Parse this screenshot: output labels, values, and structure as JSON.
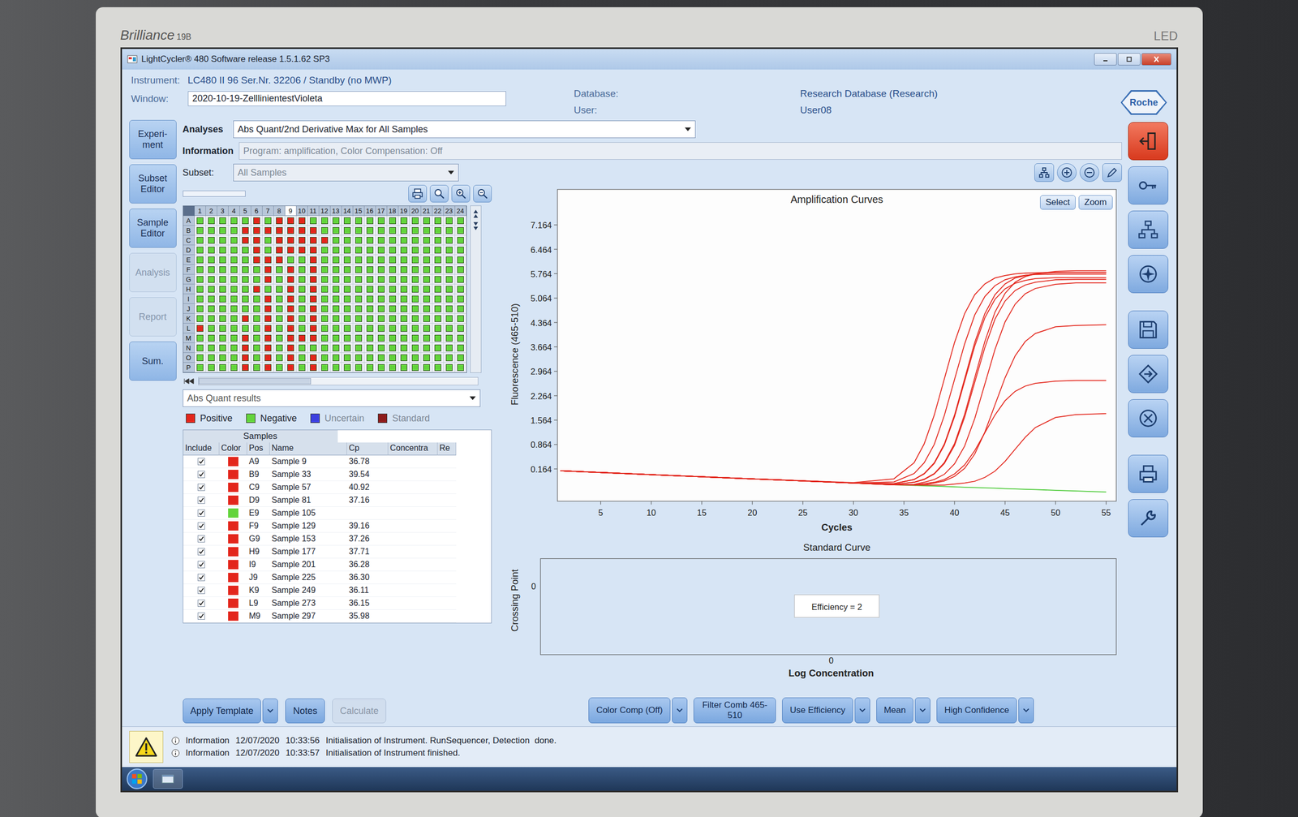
{
  "monitor": {
    "brand": "Brilliance",
    "model": "19B",
    "badge": "LED"
  },
  "window": {
    "title": "LightCycler® 480 Software release 1.5.1.62 SP3"
  },
  "header": {
    "instrument_label": "Instrument:",
    "instrument": "LC480 II 96 Ser.Nr. 32206 / Standby (no MWP)",
    "window_label": "Window:",
    "window_value": "2020-10-19-ZelllinientestVioleta",
    "database_label": "Database:",
    "database": "Research Database (Research)",
    "user_label": "User:",
    "user": "User08",
    "logo": "Roche"
  },
  "sidebar": {
    "items": [
      {
        "label": "Experi-ment",
        "disabled": false
      },
      {
        "label": "Subset Editor",
        "disabled": false
      },
      {
        "label": "Sample Editor",
        "disabled": false
      },
      {
        "label": "Analysis",
        "disabled": true
      },
      {
        "label": "Report",
        "disabled": true
      },
      {
        "label": "Sum.",
        "disabled": false
      }
    ]
  },
  "analyses": {
    "label": "Analyses",
    "value": "Abs Quant/2nd Derivative Max for All Samples"
  },
  "information": {
    "label": "Information",
    "value": "Program: amplification, Color Compensation: Off"
  },
  "subset": {
    "label": "Subset:",
    "value": "All Samples"
  },
  "plate": {
    "columns": [
      {
        "label": "1",
        "selected": false
      },
      {
        "label": "2",
        "selected": false
      },
      {
        "label": "3",
        "selected": false
      },
      {
        "label": "4",
        "selected": false
      },
      {
        "label": "5",
        "selected": false
      },
      {
        "label": "6",
        "selected": false
      },
      {
        "label": "7",
        "selected": false
      },
      {
        "label": "8",
        "selected": false
      },
      {
        "label": "9",
        "selected": true
      },
      {
        "label": "10",
        "selected": false
      },
      {
        "label": "11",
        "selected": false
      },
      {
        "label": "12",
        "selected": false
      },
      {
        "label": "13",
        "selected": false
      },
      {
        "label": "14",
        "selected": false
      },
      {
        "label": "15",
        "selected": false
      },
      {
        "label": "16",
        "selected": false
      },
      {
        "label": "17",
        "selected": false
      },
      {
        "label": "18",
        "selected": false
      },
      {
        "label": "19",
        "selected": false
      },
      {
        "label": "20",
        "selected": false
      },
      {
        "label": "21",
        "selected": false
      },
      {
        "label": "22",
        "selected": false
      },
      {
        "label": "23",
        "selected": false
      },
      {
        "label": "24",
        "selected": false
      }
    ],
    "rows": [
      {
        "label": "A",
        "positive": [
          false,
          false,
          false,
          false,
          false,
          true,
          false,
          true,
          true,
          true,
          false,
          false,
          false,
          false,
          false,
          false,
          false,
          false,
          false,
          false,
          false,
          false,
          false,
          false
        ]
      },
      {
        "label": "B",
        "positive": [
          false,
          false,
          false,
          false,
          true,
          true,
          true,
          true,
          true,
          true,
          true,
          false,
          false,
          false,
          false,
          false,
          false,
          false,
          false,
          false,
          false,
          false,
          false,
          false
        ]
      },
      {
        "label": "C",
        "positive": [
          false,
          false,
          false,
          false,
          true,
          true,
          false,
          true,
          true,
          true,
          true,
          true,
          false,
          false,
          false,
          false,
          false,
          false,
          false,
          false,
          false,
          false,
          false,
          false
        ]
      },
      {
        "label": "D",
        "positive": [
          false,
          false,
          false,
          false,
          false,
          true,
          false,
          true,
          true,
          true,
          true,
          false,
          false,
          false,
          false,
          false,
          false,
          false,
          false,
          false,
          false,
          false,
          false,
          false
        ]
      },
      {
        "label": "E",
        "positive": [
          false,
          false,
          false,
          false,
          false,
          true,
          true,
          true,
          false,
          false,
          true,
          false,
          false,
          false,
          false,
          false,
          false,
          false,
          false,
          false,
          false,
          false,
          false,
          false
        ]
      },
      {
        "label": "F",
        "positive": [
          false,
          false,
          false,
          false,
          false,
          false,
          true,
          false,
          true,
          false,
          true,
          false,
          false,
          false,
          false,
          false,
          false,
          false,
          false,
          false,
          false,
          false,
          false,
          false
        ]
      },
      {
        "label": "G",
        "positive": [
          false,
          false,
          false,
          false,
          false,
          false,
          true,
          false,
          true,
          false,
          true,
          false,
          false,
          false,
          false,
          false,
          false,
          false,
          false,
          false,
          false,
          false,
          false,
          false
        ]
      },
      {
        "label": "H",
        "positive": [
          false,
          false,
          false,
          false,
          false,
          true,
          false,
          false,
          true,
          false,
          true,
          false,
          false,
          false,
          false,
          false,
          false,
          false,
          false,
          false,
          false,
          false,
          false,
          false
        ]
      },
      {
        "label": "I",
        "positive": [
          false,
          false,
          false,
          false,
          false,
          false,
          true,
          false,
          true,
          false,
          true,
          false,
          false,
          false,
          false,
          false,
          false,
          false,
          false,
          false,
          false,
          false,
          false,
          false
        ]
      },
      {
        "label": "J",
        "positive": [
          false,
          false,
          false,
          false,
          false,
          false,
          true,
          false,
          true,
          false,
          true,
          false,
          false,
          false,
          false,
          false,
          false,
          false,
          false,
          false,
          false,
          false,
          false,
          false
        ]
      },
      {
        "label": "K",
        "positive": [
          false,
          false,
          false,
          false,
          true,
          false,
          true,
          false,
          true,
          false,
          true,
          false,
          false,
          false,
          false,
          false,
          false,
          false,
          false,
          false,
          false,
          false,
          false,
          false
        ]
      },
      {
        "label": "L",
        "positive": [
          true,
          false,
          false,
          false,
          false,
          false,
          true,
          false,
          true,
          false,
          true,
          false,
          false,
          false,
          false,
          false,
          false,
          false,
          false,
          false,
          false,
          false,
          false,
          false
        ]
      },
      {
        "label": "M",
        "positive": [
          false,
          false,
          false,
          false,
          true,
          false,
          true,
          false,
          true,
          true,
          true,
          false,
          false,
          false,
          false,
          false,
          false,
          false,
          false,
          false,
          false,
          false,
          false,
          false
        ]
      },
      {
        "label": "N",
        "positive": [
          false,
          false,
          false,
          false,
          true,
          false,
          true,
          false,
          true,
          false,
          false,
          false,
          false,
          false,
          false,
          false,
          false,
          false,
          false,
          false,
          false,
          false,
          false,
          false
        ]
      },
      {
        "label": "O",
        "positive": [
          false,
          false,
          false,
          false,
          true,
          false,
          true,
          false,
          true,
          false,
          true,
          false,
          false,
          false,
          false,
          false,
          false,
          false,
          false,
          false,
          false,
          false,
          false,
          false
        ]
      },
      {
        "label": "P",
        "positive": [
          false,
          false,
          false,
          false,
          true,
          false,
          true,
          false,
          true,
          false,
          true,
          false,
          false,
          false,
          false,
          false,
          false,
          false,
          false,
          false,
          false,
          false,
          false,
          false
        ]
      }
    ]
  },
  "results": {
    "value": "Abs Quant results"
  },
  "legend": [
    {
      "label": "Positive",
      "color": "#e3261c",
      "disabled": false
    },
    {
      "label": "Negative",
      "color": "#63d43c",
      "disabled": false
    },
    {
      "label": "Uncertain",
      "color": "#3b3fe0",
      "disabled": true
    },
    {
      "label": "Standard",
      "color": "#8e1c1c",
      "disabled": true
    }
  ],
  "samples": {
    "title": "Samples",
    "columns": [
      "Include",
      "Color",
      "Pos",
      "Name",
      "Cp",
      "Concentra",
      "Re"
    ],
    "rows": [
      {
        "included": true,
        "positive": true,
        "pos": "A9",
        "name": "Sample 9",
        "cp": "36.78",
        "concentration": ""
      },
      {
        "included": true,
        "positive": true,
        "pos": "B9",
        "name": "Sample 33",
        "cp": "39.54",
        "concentration": ""
      },
      {
        "included": true,
        "positive": true,
        "pos": "C9",
        "name": "Sample 57",
        "cp": "40.92",
        "concentration": ""
      },
      {
        "included": true,
        "positive": true,
        "pos": "D9",
        "name": "Sample 81",
        "cp": "37.16",
        "concentration": ""
      },
      {
        "included": true,
        "positive": false,
        "pos": "E9",
        "name": "Sample 105",
        "cp": "",
        "concentration": ""
      },
      {
        "included": true,
        "positive": true,
        "pos": "F9",
        "name": "Sample 129",
        "cp": "39.16",
        "concentration": ""
      },
      {
        "included": true,
        "positive": true,
        "pos": "G9",
        "name": "Sample 153",
        "cp": "37.26",
        "concentration": ""
      },
      {
        "included": true,
        "positive": true,
        "pos": "H9",
        "name": "Sample 177",
        "cp": "37.71",
        "concentration": ""
      },
      {
        "included": true,
        "positive": true,
        "pos": "I9",
        "name": "Sample 201",
        "cp": "36.28",
        "concentration": ""
      },
      {
        "included": true,
        "positive": true,
        "pos": "J9",
        "name": "Sample 225",
        "cp": "36.30",
        "concentration": ""
      },
      {
        "included": true,
        "positive": true,
        "pos": "K9",
        "name": "Sample 249",
        "cp": "36.11",
        "concentration": ""
      },
      {
        "included": true,
        "positive": true,
        "pos": "L9",
        "name": "Sample 273",
        "cp": "36.15",
        "concentration": ""
      },
      {
        "included": true,
        "positive": true,
        "pos": "M9",
        "name": "Sample 297",
        "cp": "35.98",
        "concentration": ""
      }
    ]
  },
  "left_buttons": [
    {
      "label": "Apply Template",
      "dropdown": true,
      "disabled": false
    },
    {
      "label": "Notes",
      "dropdown": false,
      "disabled": false
    },
    {
      "label": "Calculate",
      "dropdown": false,
      "disabled": true
    }
  ],
  "chart": {
    "title": "Amplification Curves",
    "y_label": "Fluorescence (465-510)",
    "x_label": "Cycles",
    "y_ticks": [
      "0.164",
      "0.864",
      "1.564",
      "2.264",
      "2.964",
      "3.664",
      "4.364",
      "5.064",
      "5.764",
      "6.464",
      "7.164"
    ],
    "x_ticks": [
      "5",
      "10",
      "15",
      "20",
      "25",
      "30",
      "35",
      "40",
      "45",
      "50",
      "55"
    ],
    "buttons": [
      "Select",
      "Zoom"
    ],
    "cycles": [
      1,
      10,
      20,
      30,
      34,
      36,
      37,
      38,
      39,
      40,
      41,
      42,
      43,
      44,
      45,
      46,
      47,
      48,
      50,
      52,
      55
    ],
    "series": [
      {
        "color": "#4ecb3a",
        "values": [
          0.11,
          0.0,
          -0.12,
          -0.24,
          -0.29,
          -0.31,
          -0.32,
          -0.33,
          -0.34,
          -0.35,
          -0.36,
          -0.37,
          -0.38,
          -0.39,
          -0.4,
          -0.41,
          -0.42,
          -0.43,
          -0.45,
          -0.47,
          -0.5
        ]
      },
      {
        "color": "#e3261c",
        "values": [
          0.11,
          0.0,
          -0.12,
          -0.23,
          -0.12,
          0.34,
          0.88,
          1.71,
          2.75,
          3.79,
          4.62,
          5.16,
          5.47,
          5.64,
          5.71,
          5.76,
          5.78,
          5.79,
          5.8,
          5.8,
          5.8
        ]
      },
      {
        "color": "#e3261c",
        "values": [
          0.11,
          0.0,
          -0.12,
          -0.24,
          -0.21,
          0.03,
          0.34,
          0.87,
          1.7,
          2.73,
          3.75,
          4.58,
          5.11,
          5.42,
          5.59,
          5.67,
          5.72,
          5.74,
          5.75,
          5.75,
          5.75
        ]
      },
      {
        "color": "#e3261c",
        "values": [
          0.11,
          0.0,
          -0.12,
          -0.24,
          -0.26,
          -0.14,
          0.02,
          0.32,
          0.85,
          1.66,
          2.68,
          3.69,
          4.5,
          5.03,
          5.33,
          5.49,
          5.57,
          5.62,
          5.65,
          5.65,
          5.65
        ]
      },
      {
        "color": "#e3261c",
        "values": [
          0.11,
          0.0,
          -0.12,
          -0.24,
          -0.26,
          -0.14,
          0.03,
          0.34,
          0.88,
          1.71,
          2.75,
          3.79,
          4.62,
          5.16,
          5.47,
          5.64,
          5.71,
          5.76,
          5.8,
          5.8,
          5.8
        ]
      },
      {
        "color": "#e3261c",
        "values": [
          0.11,
          0.0,
          -0.12,
          -0.24,
          -0.28,
          -0.22,
          -0.14,
          0.02,
          0.32,
          0.84,
          1.65,
          2.65,
          3.65,
          4.46,
          4.98,
          5.28,
          5.44,
          5.52,
          5.59,
          5.6,
          5.6
        ]
      },
      {
        "color": "#e3261c",
        "values": [
          0.11,
          0.0,
          -0.12,
          -0.24,
          -0.28,
          -0.22,
          -0.13,
          0.03,
          0.35,
          0.89,
          1.73,
          2.78,
          3.82,
          4.66,
          5.2,
          5.52,
          5.68,
          5.76,
          5.83,
          5.85,
          5.85
        ]
      },
      {
        "color": "#e3261c",
        "values": [
          0.11,
          0.0,
          -0.12,
          -0.24,
          -0.29,
          -0.28,
          -0.22,
          -0.14,
          0.01,
          0.31,
          0.82,
          1.61,
          2.6,
          3.59,
          4.38,
          4.89,
          5.19,
          5.34,
          5.46,
          5.5,
          5.5
        ]
      },
      {
        "color": "#e3261c",
        "values": [
          0.11,
          0.0,
          -0.12,
          -0.24,
          -0.29,
          -0.29,
          -0.29,
          -0.24,
          -0.18,
          -0.05,
          0.18,
          0.59,
          1.22,
          2.0,
          2.78,
          3.41,
          3.82,
          4.05,
          4.24,
          4.28,
          4.3
        ]
      },
      {
        "color": "#e3261c",
        "values": [
          0.11,
          0.0,
          -0.12,
          -0.24,
          -0.29,
          -0.29,
          -0.26,
          -0.22,
          -0.14,
          0.02,
          0.28,
          0.69,
          1.2,
          1.71,
          2.12,
          2.39,
          2.54,
          2.62,
          2.68,
          2.7,
          2.7
        ]
      },
      {
        "color": "#e3261c",
        "values": [
          0.11,
          0.0,
          -0.12,
          -0.24,
          -0.29,
          -0.3,
          -0.3,
          -0.3,
          -0.3,
          -0.27,
          -0.24,
          -0.19,
          -0.08,
          0.1,
          0.38,
          0.73,
          1.07,
          1.35,
          1.64,
          1.72,
          1.75
        ]
      }
    ]
  },
  "standard_curve": {
    "title": "Standard Curve",
    "y_label": "Crossing Point",
    "y_tick": "0",
    "x_tick": "0",
    "x_label": "Log Concentration",
    "efficiency": "Efficiency = 2"
  },
  "chart_buttons": [
    {
      "label": "Color Comp (Off)",
      "dropdown": true
    },
    {
      "label": "Filter Comb 465-510",
      "dropdown": false
    },
    {
      "label": "Use Efficiency",
      "dropdown": true
    },
    {
      "label": "Mean",
      "dropdown": true
    },
    {
      "label": "High Confidence",
      "dropdown": true
    }
  ],
  "log": [
    {
      "level": "Information",
      "date": "12/07/2020",
      "time": "10:33:56",
      "message": "Initialisation of Instrument. RunSequencer, Detection  done."
    },
    {
      "level": "Information",
      "date": "12/07/2020",
      "time": "10:33:57",
      "message": "Initialisation of Instrument finished."
    }
  ]
}
